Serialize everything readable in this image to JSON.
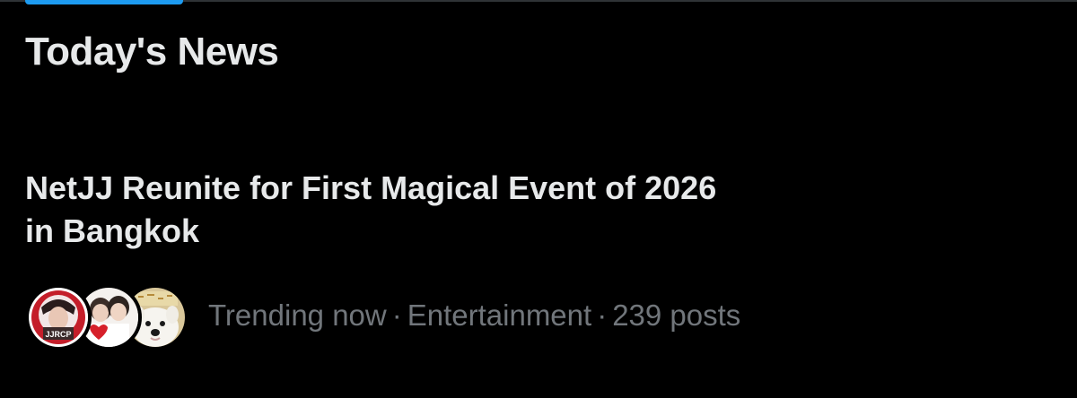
{
  "colors": {
    "background": "#000000",
    "primary_text": "#e7e9ea",
    "secondary_text": "#71767b",
    "accent": "#1d9bf0",
    "divider": "#2f3336"
  },
  "section": {
    "title": "Today's News"
  },
  "news": {
    "headline_line1": "NetJJ Reunite for First Magical Event of 2026",
    "headline_line2": "in Bangkok",
    "avatars": [
      {
        "icon": "avatar-fan-account",
        "badge": "JJRCP"
      },
      {
        "icon": "avatar-duo-photo"
      },
      {
        "icon": "avatar-white-dog"
      }
    ],
    "meta": {
      "status": "Trending now",
      "separator": "·",
      "category": "Entertainment",
      "post_count": "239 posts"
    }
  }
}
